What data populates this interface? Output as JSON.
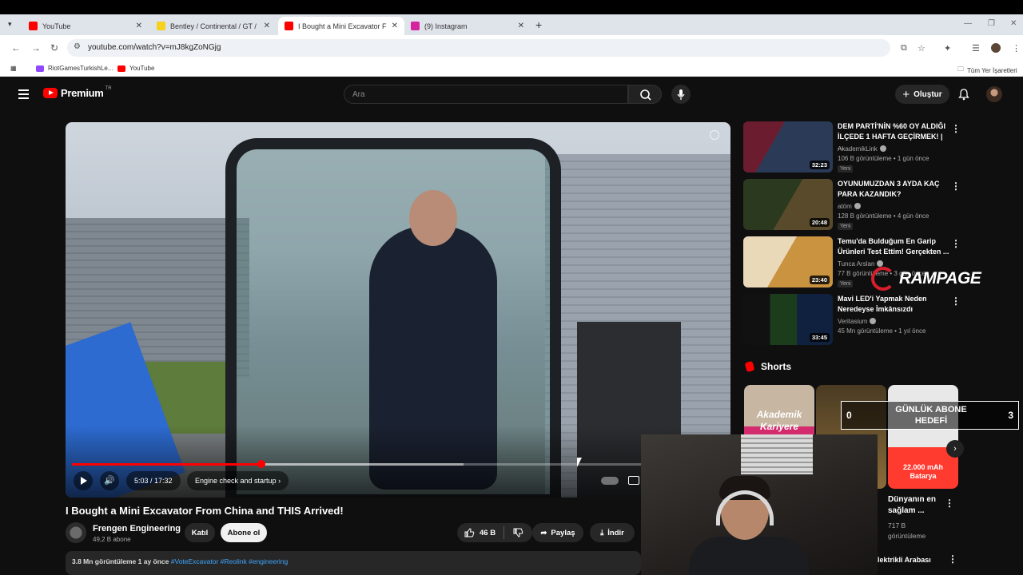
{
  "browser": {
    "tabs": [
      {
        "title": "YouTube",
        "favicon_color": "#ff0000",
        "close": "✕"
      },
      {
        "title": "Bentley / Continental / GT / BAŞ",
        "favicon_color": "#f4d21f",
        "close": "✕"
      },
      {
        "title": "I Bought a Mini Excavator From",
        "favicon_color": "#ff0000",
        "close": "✕"
      },
      {
        "title": "(9) Instagram",
        "favicon_color": "#d6249f",
        "close": "✕"
      }
    ],
    "url": "youtube.com/watch?v=mJ8kgZoNGjg",
    "bookmarks": [
      {
        "label": "RiotGamesTurkishLe...",
        "color": "#9146ff"
      },
      {
        "label": "YouTube",
        "color": "#ff0000"
      }
    ],
    "all_bookmarks": "Tüm Yer İşaretleri"
  },
  "youtube": {
    "logo_text": "Premium",
    "logo_region": "TR",
    "search_placeholder": "Ara",
    "create_label": "Oluştur",
    "video": {
      "progress_fraction": 0.29,
      "buffered_fraction": 0.6,
      "time": "5:03 / 17:32",
      "chapter": "Engine check and startup  ›"
    },
    "title": "I Bought a Mini Excavator From China and THIS Arrived!",
    "channel": {
      "name": "Frengen Engineering",
      "subs": "49,2 B abone"
    },
    "join_label": "Katıl",
    "subscribe_label": "Abone ol",
    "likes": "46 B",
    "share_label": "Paylaş",
    "download_label": "İndir",
    "desc": {
      "stats": "3.8 Mn görüntüleme  1 ay önce",
      "tags": "#VoteExcavator #Reolink #engineering"
    },
    "recommendations": [
      {
        "title": "DEM PARTİ'NİN %60 OY ALDIĞI İLÇEDE 1 HAFTA GEÇİRMEK! | ...",
        "channel": "AkademikLink",
        "meta": "106 B görüntüleme • 1 gün önce",
        "badge": "Yeni",
        "duration": "32:23"
      },
      {
        "title": "OYUNUMUZDAN 3 AYDA KAÇ PARA KAZANDIK?",
        "channel": "atöm",
        "meta": "128 B görüntüleme • 4 gün önce",
        "badge": "Yeni",
        "duration": "20:48"
      },
      {
        "title": "Temu'da Bulduğum En Garip Ürünleri Test Ettim! Gerçekten ...",
        "channel": "Tunca Arslan",
        "meta": "77 B görüntüleme • 3 gün önce",
        "badge": "Yeni",
        "duration": "23:40"
      },
      {
        "title": "Mavi LED'i Yapmak Neden Neredeyse İmkânsızdı",
        "channel": "Veritasium",
        "meta": "45 Mn görüntüleme • 1 yıl önce",
        "badge": "",
        "duration": "33:45"
      }
    ],
    "shorts_heading": "Shorts",
    "shorts": [
      {
        "caption": "Akademik Kariyere"
      },
      {
        "caption": ""
      },
      {
        "caption": "22.000 mAh Batarya"
      }
    ],
    "short_title": "Dünyanın en sağlam ...",
    "short_views": "717 B görüntüleme",
    "bottom_title": "lektrikli Arabası"
  },
  "overlay": {
    "goal_title": "GÜNLÜK ABONE HEDEFİ",
    "goal_current": "0",
    "goal_target": "3",
    "brand": "RAMPAGE"
  }
}
